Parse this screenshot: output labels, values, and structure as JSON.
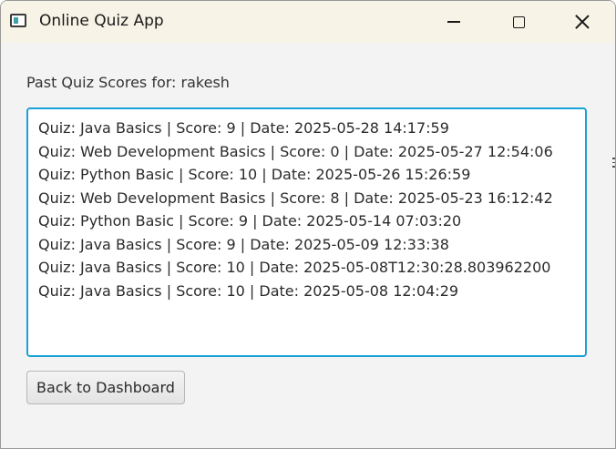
{
  "window": {
    "title": "Online Quiz App",
    "icon": "app-window-icon",
    "controls": {
      "minimize": "minimize-icon",
      "maximize": "maximize-icon",
      "close": "close-icon"
    }
  },
  "main": {
    "heading": "Past Quiz Scores for: rakesh",
    "scores": [
      "Quiz: Java Basics | Score: 9 | Date: 2025-05-28 14:17:59",
      "Quiz: Web Development Basics | Score: 0 | Date: 2025-05-27 12:54:06",
      "Quiz: Python Basic | Score: 10 | Date: 2025-05-26 15:26:59",
      "Quiz: Web Development Basics | Score: 8 | Date: 2025-05-23 16:12:42",
      "Quiz: Python Basic | Score: 9 | Date: 2025-05-14 07:03:20",
      "Quiz: Java Basics | Score: 9 | Date: 2025-05-09 12:33:38",
      "Quiz: Java Basics | Score: 10 | Date: 2025-05-08T12:30:28.803962200",
      "Quiz: Java Basics | Score: 10 | Date: 2025-05-08 12:04:29"
    ],
    "back_button_label": "Back to Dashboard"
  },
  "colors": {
    "titlebar": "#f7f3e6",
    "window_bg": "#f3f3f3",
    "focus_border": "#1aa1d8"
  }
}
